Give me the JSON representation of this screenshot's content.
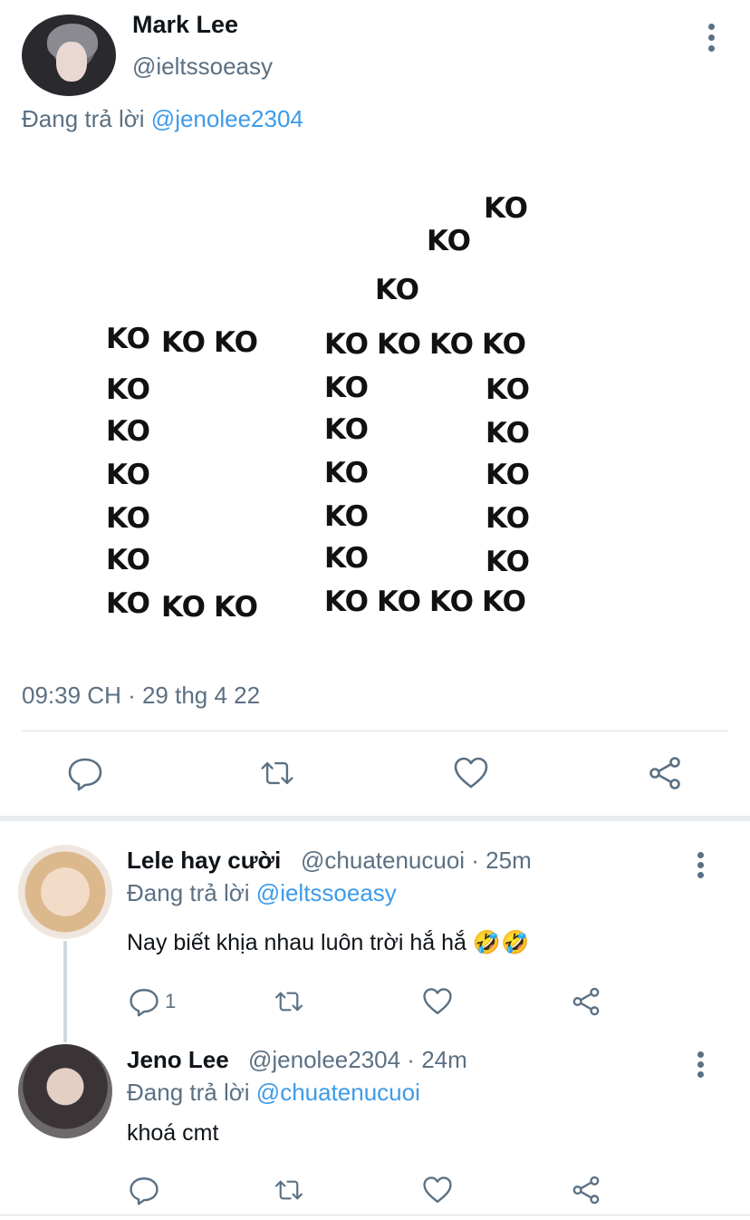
{
  "main_tweet": {
    "author_name": "Mark Lee",
    "author_handle": "@ieltssoeasy",
    "replying_prefix": "Đang trả lời",
    "replying_to": "@jenolee2304",
    "image_text": "KO",
    "timestamp": "09:39 CH · 29 thg 4 22"
  },
  "replies": [
    {
      "author_name": "Lele hay cười",
      "meta": "@chuatenucuoi · 25m",
      "replying_prefix": "Đang trả lời",
      "replying_to": "@ieltssoeasy",
      "text": "Nay biết khịa nhau luôn trời hắ hắ 🤣🤣",
      "reply_count": "1"
    },
    {
      "author_name": "Jeno Lee",
      "meta": "@jenolee2304 · 24m",
      "replying_prefix": "Đang trả lời",
      "replying_to": "@chuatenucuoi",
      "text": "khoá cmt"
    }
  ],
  "icons": {
    "reply": "speech-bubble-icon",
    "retweet": "retweet-arrows-icon",
    "like": "heart-icon",
    "share": "share-nodes-icon",
    "more": "vertical-dots-icon"
  },
  "colors": {
    "link": "#3d9be9",
    "secondary_text": "#5b7083",
    "primary_text": "#0f1419",
    "divider": "#dbe1e6"
  }
}
